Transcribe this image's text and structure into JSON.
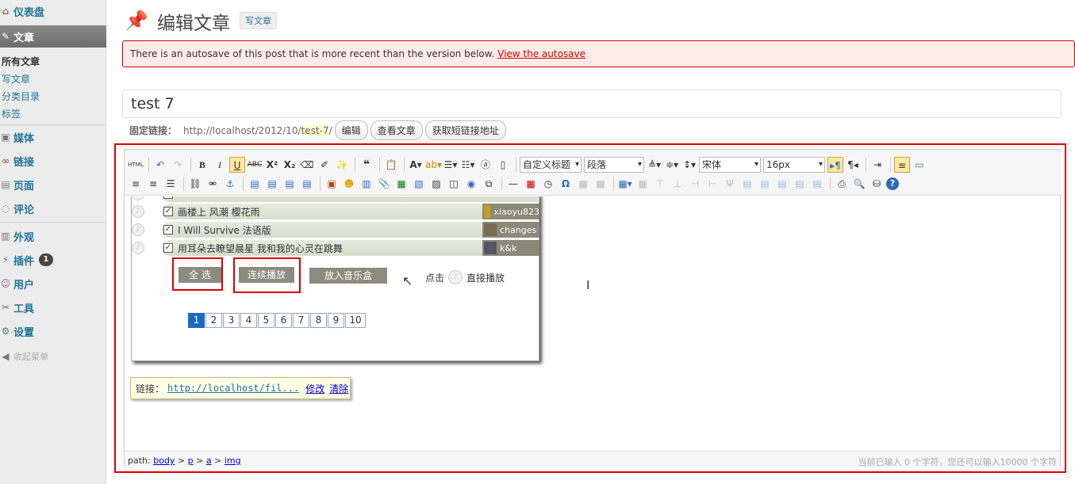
{
  "sidebar": {
    "dashboard": "仪表盘",
    "posts": "文章",
    "posts_sub": [
      "所有文章",
      "写文章",
      "分类目录",
      "标签"
    ],
    "media": "媒体",
    "links": "链接",
    "pages": "页面",
    "comments": "评论",
    "appearance": "外观",
    "plugins": "插件",
    "plugins_badge": "1",
    "users": "用户",
    "tools": "工具",
    "settings": "设置",
    "collapse": "收起菜单"
  },
  "header": {
    "title": "编辑文章",
    "add_new": "写文章"
  },
  "notice": {
    "text": "There is an autosave of this post that is more recent than the version below.",
    "link": "View the autosave"
  },
  "post": {
    "title": "test 7",
    "permalink_label": "固定链接：",
    "permalink_base": "http://localhost/2012/10/",
    "slug": "test-7",
    "permalink_end": "/",
    "edit_btn": "编辑",
    "view_btn": "查看文章",
    "shortlink_btn": "获取短链接地址"
  },
  "toolbar": {
    "style_select": "自定义标题",
    "format_select": "段落",
    "font_select": "宋体",
    "size_select": "16px"
  },
  "music": {
    "tracks": [
      {
        "name": "画楼上 风潮 樱花雨",
        "user": "xiaoyu823"
      },
      {
        "name": "I Will Survive 法语版",
        "user": "changes"
      },
      {
        "name": "用耳朵去瞭望晨星 我和我的心灵在跳舞",
        "user": "k&k"
      }
    ],
    "btn_select_all": "全 选",
    "btn_play_all": "连续播放",
    "btn_add_box": "放入音乐盒",
    "hint_click": "点击",
    "hint_play": "直接播放",
    "pages": [
      "1",
      "2",
      "3",
      "4",
      "5",
      "6",
      "7",
      "8",
      "9",
      "10"
    ]
  },
  "linktip": {
    "label": "链接：",
    "url": "http://localhost/fil...",
    "edit": "修改",
    "clear": "清除"
  },
  "statusbar": {
    "path_label": "path:",
    "path": [
      "body",
      "p",
      "a",
      "img"
    ],
    "count": "当前已输入 0 个字符，您还可以输入10000 个字符"
  }
}
